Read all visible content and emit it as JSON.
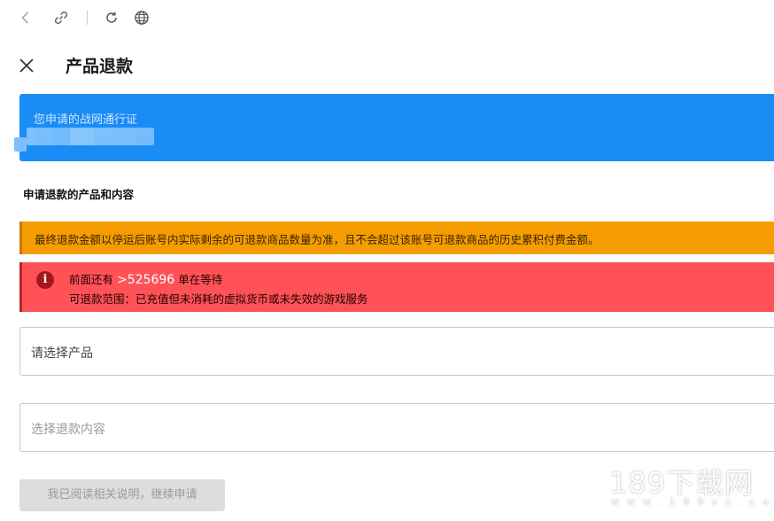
{
  "toolbar": {
    "icons": [
      "back-icon",
      "link-icon",
      "refresh-icon",
      "globe-icon"
    ]
  },
  "header": {
    "title": "产品退款"
  },
  "account_card": {
    "label": "您申请的战网通行证",
    "value_masked": true
  },
  "section_title": "申请退款的产品和内容",
  "warning_notice": {
    "text": "最终退款金额以停运后账号内实际剩余的可退款商品数量为准，且不会超过该账号可退款商品的历史累积付费金额。",
    "color": "#f59d00"
  },
  "error_notice": {
    "prefix": "前面还有",
    "count": ">525696",
    "suffix": "单在等待",
    "scope": "可退款范围：已充值但未消耗的虚拟货币或未失效的游戏服务",
    "color": "#ff5257"
  },
  "product_select": {
    "placeholder": "请选择产品"
  },
  "content_select": {
    "placeholder": "选择退款内容"
  },
  "continue_button": {
    "label": "我已阅读相关说明，继续申请"
  },
  "watermark": {
    "main": "189下载网",
    "sub": "www.189xz.com"
  },
  "colors": {
    "accent_blue": "#1a8cf5"
  }
}
